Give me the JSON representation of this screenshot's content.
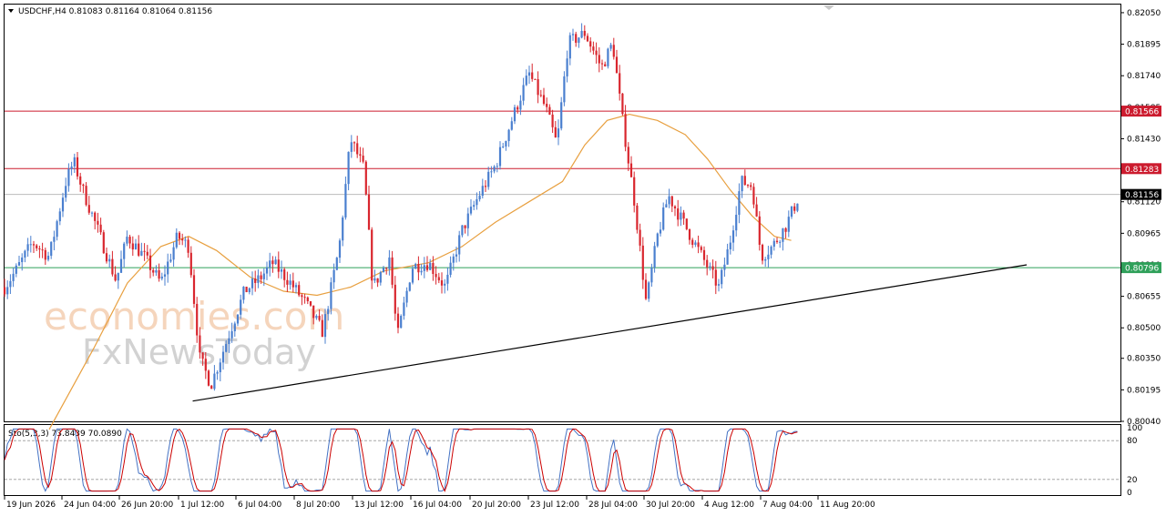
{
  "header": {
    "symbol_label": "USDCHF,H4  0.81083 0.81164 0.81064 0.81156",
    "triangle_icon": "dropdown-triangle-icon"
  },
  "watermark": {
    "line1": "economies.com",
    "line2": "FxNewsToday"
  },
  "oscillator": {
    "label": "Sto(5,3,3) 73.8439 70.0890",
    "levels": [
      "100",
      "80",
      "20",
      "0"
    ],
    "main_color": "#4472c4",
    "signal_color": "#cc0000"
  },
  "colors": {
    "bull": "#4a7fcf",
    "bear": "#d9262e",
    "ma": "#e8a040",
    "trendline": "#000000",
    "resistance": "#cc1b2e",
    "support": "#2fa05a",
    "current": "#bbbbbb"
  },
  "chart_data": {
    "type": "candlestick",
    "symbol": "USDCHF",
    "timeframe": "H4",
    "ylim": [
      0.8004,
      0.8209
    ],
    "y_ticks": [
      "0.82050",
      "0.81895",
      "0.81740",
      "0.81585",
      "0.81430",
      "0.81275",
      "0.81120",
      "0.80965",
      "0.80810",
      "0.80655",
      "0.80500",
      "0.80350",
      "0.80195",
      "0.80040"
    ],
    "x_ticks": [
      "19 Jun 2026",
      "24 Jun 04:00",
      "26 Jun 20:00",
      "1 Jul 12:00",
      "6 Jul 04:00",
      "8 Jul 20:00",
      "13 Jul 12:00",
      "16 Jul 04:00",
      "20 Jul 20:00",
      "23 Jul 12:00",
      "28 Jul 04:00",
      "30 Jul 20:00",
      "4 Aug 12:00",
      "7 Aug 04:00",
      "11 Aug 20:00"
    ],
    "price_levels": [
      {
        "label": "0.81566",
        "value": 0.81566,
        "kind": "resistance"
      },
      {
        "label": "0.81283",
        "value": 0.81283,
        "kind": "resistance"
      },
      {
        "label": "0.81156",
        "value": 0.81156,
        "kind": "current"
      },
      {
        "label": "0.80796",
        "value": 0.80796,
        "kind": "support"
      }
    ],
    "trendline": [
      [
        0.0,
        0.8014
      ],
      [
        1.0,
        0.8081
      ]
    ],
    "trendline_x": [
      0.1686,
      0.916
    ],
    "path": [
      [
        0.0,
        0.807
      ],
      [
        0.01,
        0.8078
      ],
      [
        0.025,
        0.8092
      ],
      [
        0.04,
        0.8085
      ],
      [
        0.055,
        0.8122
      ],
      [
        0.062,
        0.8132
      ],
      [
        0.07,
        0.8118
      ],
      [
        0.085,
        0.8096
      ],
      [
        0.1,
        0.8073
      ],
      [
        0.11,
        0.8095
      ],
      [
        0.125,
        0.8085
      ],
      [
        0.14,
        0.8072
      ],
      [
        0.155,
        0.8095
      ],
      [
        0.165,
        0.809
      ],
      [
        0.175,
        0.8035
      ],
      [
        0.185,
        0.8022
      ],
      [
        0.2,
        0.8045
      ],
      [
        0.215,
        0.8068
      ],
      [
        0.23,
        0.8075
      ],
      [
        0.24,
        0.8082
      ],
      [
        0.255,
        0.8073
      ],
      [
        0.27,
        0.8062
      ],
      [
        0.285,
        0.8048
      ],
      [
        0.3,
        0.809
      ],
      [
        0.31,
        0.8143
      ],
      [
        0.322,
        0.8128
      ],
      [
        0.33,
        0.807
      ],
      [
        0.345,
        0.8085
      ],
      [
        0.352,
        0.8045
      ],
      [
        0.365,
        0.808
      ],
      [
        0.38,
        0.8082
      ],
      [
        0.395,
        0.807
      ],
      [
        0.41,
        0.8098
      ],
      [
        0.425,
        0.8115
      ],
      [
        0.44,
        0.813
      ],
      [
        0.455,
        0.8153
      ],
      [
        0.47,
        0.8175
      ],
      [
        0.485,
        0.8158
      ],
      [
        0.495,
        0.814
      ],
      [
        0.505,
        0.819
      ],
      [
        0.52,
        0.8195
      ],
      [
        0.535,
        0.8178
      ],
      [
        0.545,
        0.819
      ],
      [
        0.553,
        0.8155
      ],
      [
        0.565,
        0.811
      ],
      [
        0.575,
        0.8062
      ],
      [
        0.585,
        0.8095
      ],
      [
        0.595,
        0.8115
      ],
      [
        0.61,
        0.81
      ],
      [
        0.625,
        0.8085
      ],
      [
        0.64,
        0.807
      ],
      [
        0.65,
        0.8092
      ],
      [
        0.66,
        0.8122
      ],
      [
        0.67,
        0.812
      ],
      [
        0.678,
        0.8085
      ],
      [
        0.688,
        0.809
      ],
      [
        0.7,
        0.81
      ],
      [
        0.712,
        0.8115
      ]
    ],
    "ma_path": [
      [
        0.04,
        0.8
      ],
      [
        0.08,
        0.804
      ],
      [
        0.11,
        0.8072
      ],
      [
        0.14,
        0.809
      ],
      [
        0.165,
        0.8095
      ],
      [
        0.19,
        0.8088
      ],
      [
        0.22,
        0.8075
      ],
      [
        0.25,
        0.8068
      ],
      [
        0.28,
        0.8066
      ],
      [
        0.31,
        0.807
      ],
      [
        0.34,
        0.8078
      ],
      [
        0.38,
        0.8082
      ],
      [
        0.41,
        0.809
      ],
      [
        0.44,
        0.8102
      ],
      [
        0.47,
        0.8112
      ],
      [
        0.5,
        0.8122
      ],
      [
        0.52,
        0.814
      ],
      [
        0.54,
        0.8152
      ],
      [
        0.56,
        0.8155
      ],
      [
        0.585,
        0.8152
      ],
      [
        0.61,
        0.8145
      ],
      [
        0.63,
        0.8133
      ],
      [
        0.65,
        0.8118
      ],
      [
        0.67,
        0.8105
      ],
      [
        0.69,
        0.8095
      ],
      [
        0.705,
        0.8093
      ]
    ]
  }
}
